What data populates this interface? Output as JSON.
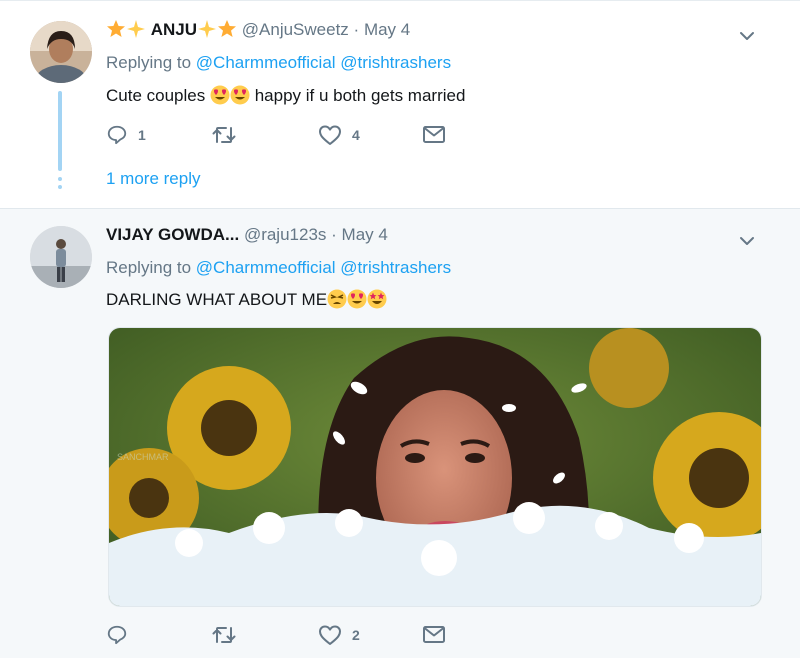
{
  "tweets": [
    {
      "name": "ANJU",
      "handle": "@AnjuSweetz",
      "separator": "·",
      "date": "May 4",
      "replying_label": "Replying to",
      "mentions": [
        "@Charmmeofficial",
        "@trishtrashers"
      ],
      "text_before": "Cute couples",
      "text_after": "happy if u both gets married",
      "counts": {
        "reply": "1",
        "retweet": "",
        "like": "4"
      },
      "more_replies": "1 more reply"
    },
    {
      "name": "VIJAY GOWDA...",
      "handle": "@raju123s",
      "separator": "·",
      "date": "May 4",
      "replying_label": "Replying to",
      "mentions": [
        "@Charmmeofficial",
        "@trishtrashers"
      ],
      "text": "DARLING WHAT ABOUT ME",
      "counts": {
        "reply": "",
        "retweet": "",
        "like": "2"
      },
      "media_watermark": "SANCHMAR"
    }
  ],
  "icons": [
    "reply-icon",
    "retweet-icon",
    "heart-icon",
    "mail-icon",
    "chevron-down-icon"
  ],
  "colors": {
    "link": "#1da1f2",
    "muted": "#657786",
    "thread_line": "#a3d4f4",
    "reply_background": "#f5f8fa"
  }
}
